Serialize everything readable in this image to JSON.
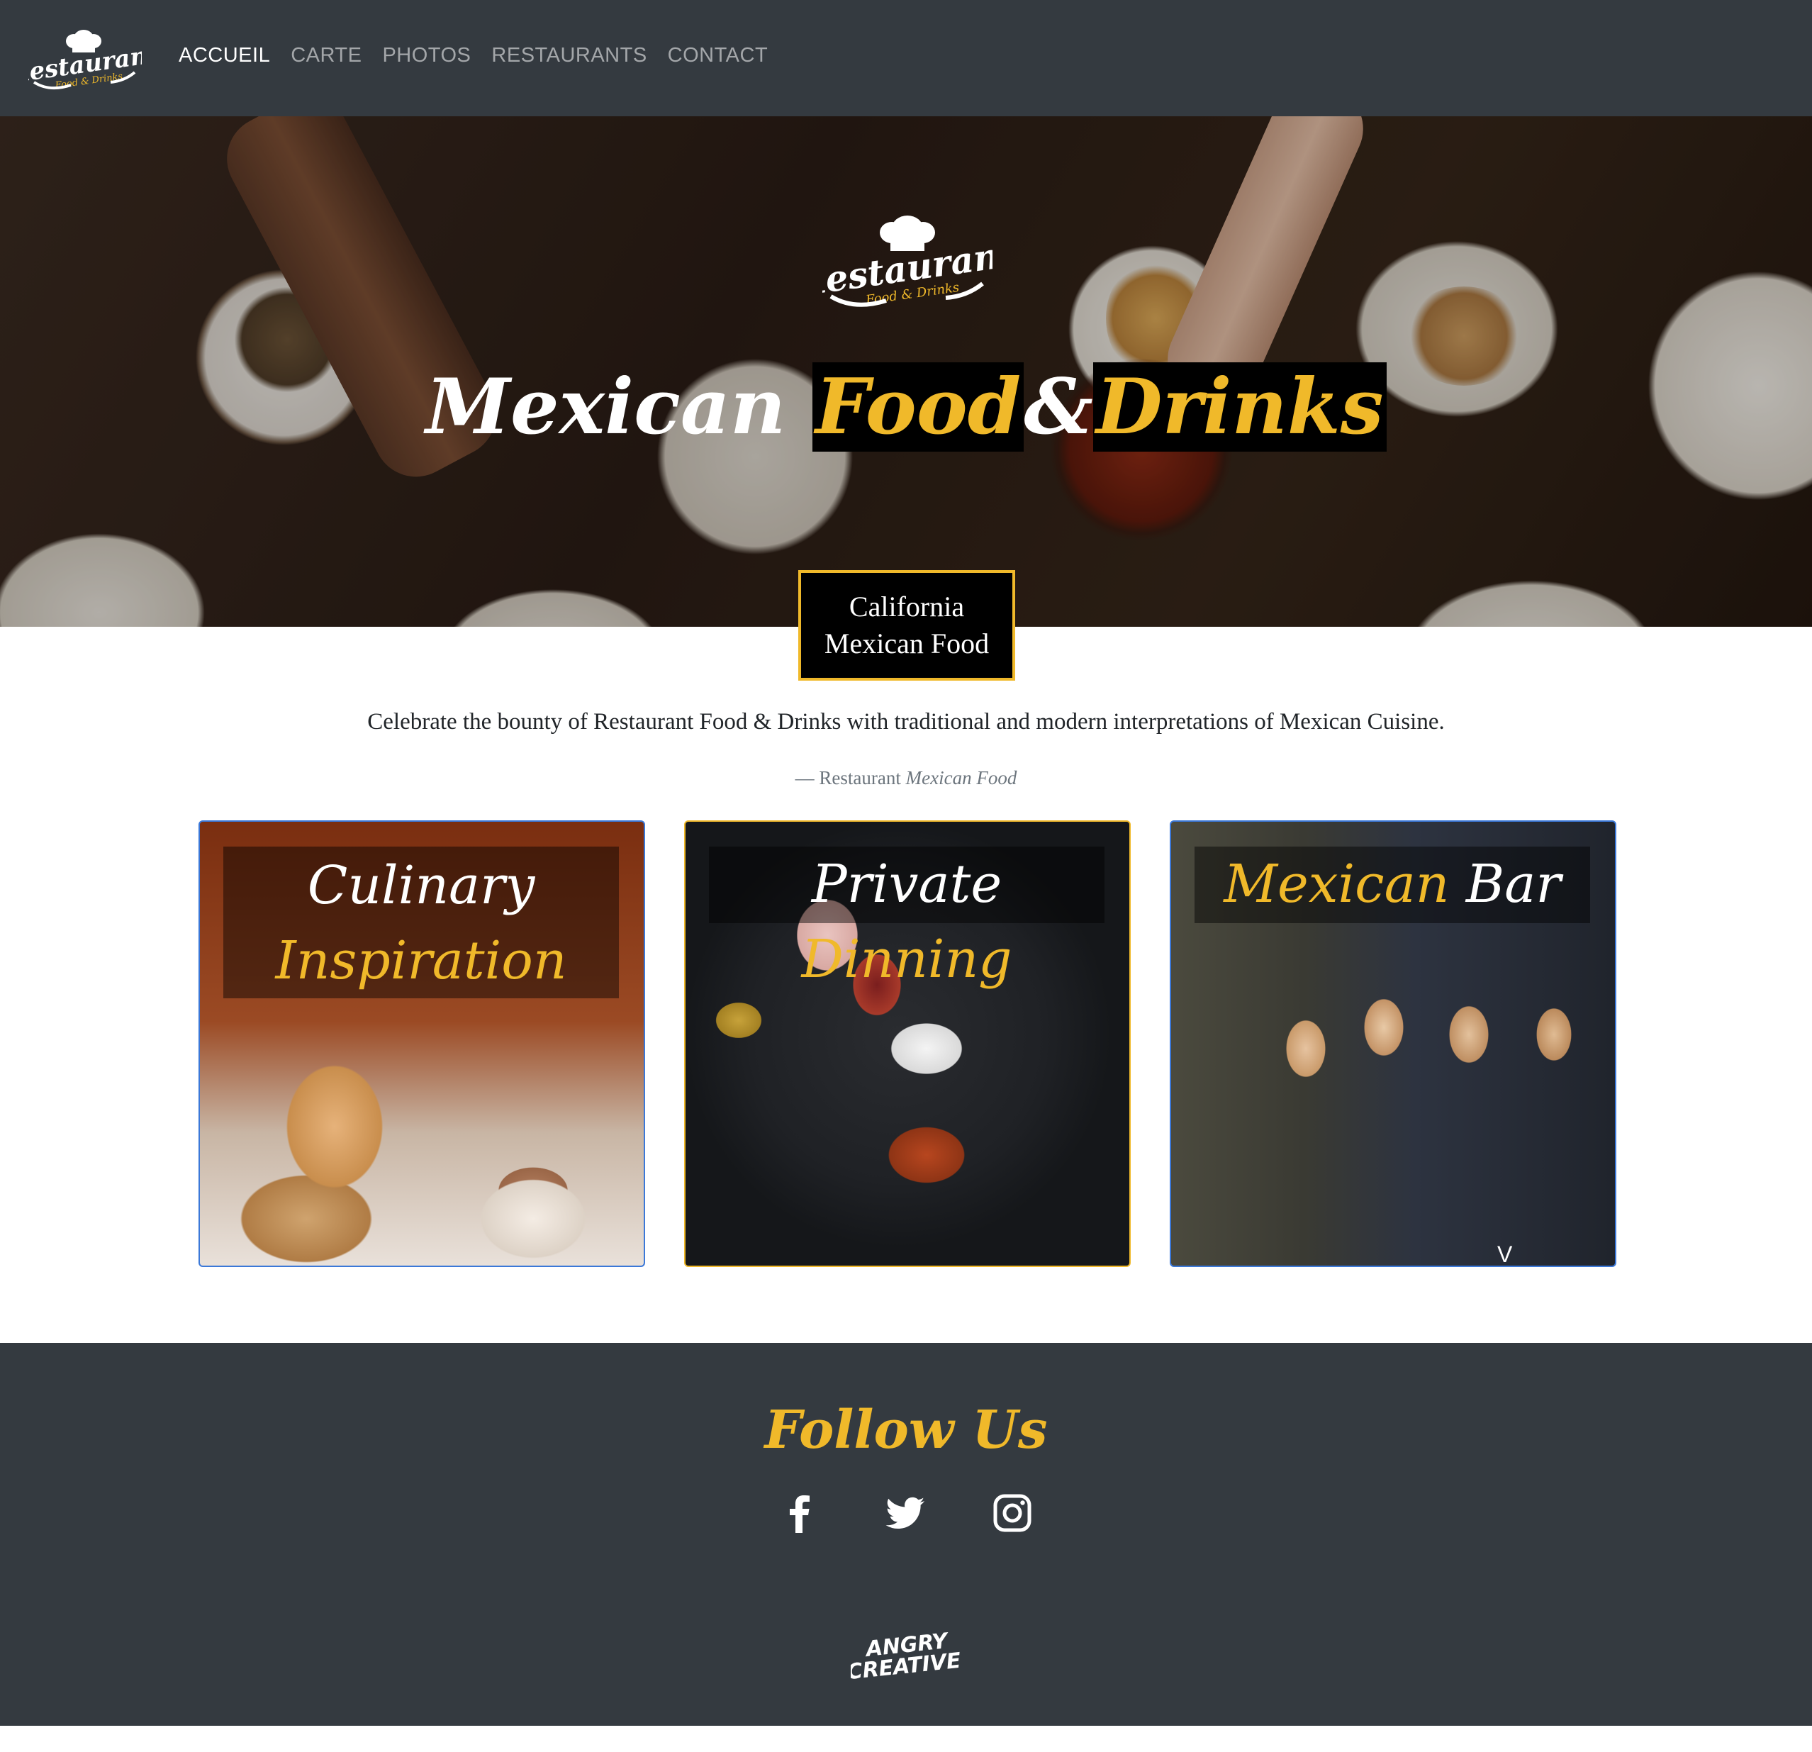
{
  "navbar": {
    "logo": {
      "word": "Restaurant",
      "sub": "Food & Drinks",
      "icon": "chef-hat-icon"
    },
    "links": [
      {
        "label": "ACCUEIL",
        "active": true
      },
      {
        "label": "CARTE",
        "active": false
      },
      {
        "label": "PHOTOS",
        "active": false
      },
      {
        "label": "RESTAURANTS",
        "active": false
      },
      {
        "label": "CONTACT",
        "active": false
      }
    ]
  },
  "hero": {
    "logo": {
      "word": "Restaurant",
      "sub": "Food & Drinks",
      "icon": "chef-hat-icon"
    },
    "title_part1": "Mexican",
    "title_part2": "Food",
    "title_amp": "&",
    "title_part3": "Drinks",
    "badge_line1": "California",
    "badge_line2": "Mexican Food"
  },
  "intro": {
    "tagline": "Celebrate the bounty of Restaurant Food & Drinks with traditional and modern interpretations of Mexican Cuisine.",
    "attribution_prefix": "— Restaurant",
    "attribution_em": "Mexican Food"
  },
  "cards": [
    {
      "line1": "Culinary",
      "line2": "Inspiration"
    },
    {
      "word1": "Private",
      "word2": "Dinning"
    },
    {
      "word1": "Mexican",
      "word2": "Bar",
      "chevron": "V"
    }
  ],
  "footer": {
    "follow": "Follow Us",
    "socials": [
      "facebook-icon",
      "twitter-icon",
      "instagram-icon"
    ],
    "brand_line1": "ANGRY",
    "brand_line2": "CREATIVE"
  },
  "colors": {
    "navbar_bg": "#343a40",
    "accent_gold": "#f0b92a",
    "link_blue": "#3b78d8",
    "text_dark": "#212529",
    "muted": "#6c757d"
  }
}
